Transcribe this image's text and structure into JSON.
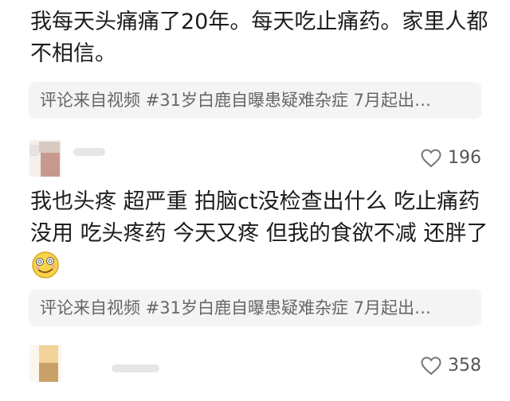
{
  "comments": [
    {
      "text": "我每天头痛痛了20年。每天吃止痛药。家里人都不相信。",
      "source": "评论来自视频 #31岁白鹿自曝患疑难杂症 7月起出…"
    },
    {
      "likes": "196",
      "text_line1": "我也头疼 超严重 拍脑ct没检查出什么 吃止痛药",
      "text_line2": "没用 吃头疼药 今天又疼 但我的食欲不减 还胖了",
      "emoji": "dizzy-smile-emoji",
      "source": "评论来自视频 #31岁白鹿自曝患疑难杂症 7月起出…"
    },
    {
      "likes": "358"
    }
  ],
  "colors": {
    "text": "#1c1c1c",
    "muted": "#666666",
    "chip_bg": "#f4f4f4"
  }
}
